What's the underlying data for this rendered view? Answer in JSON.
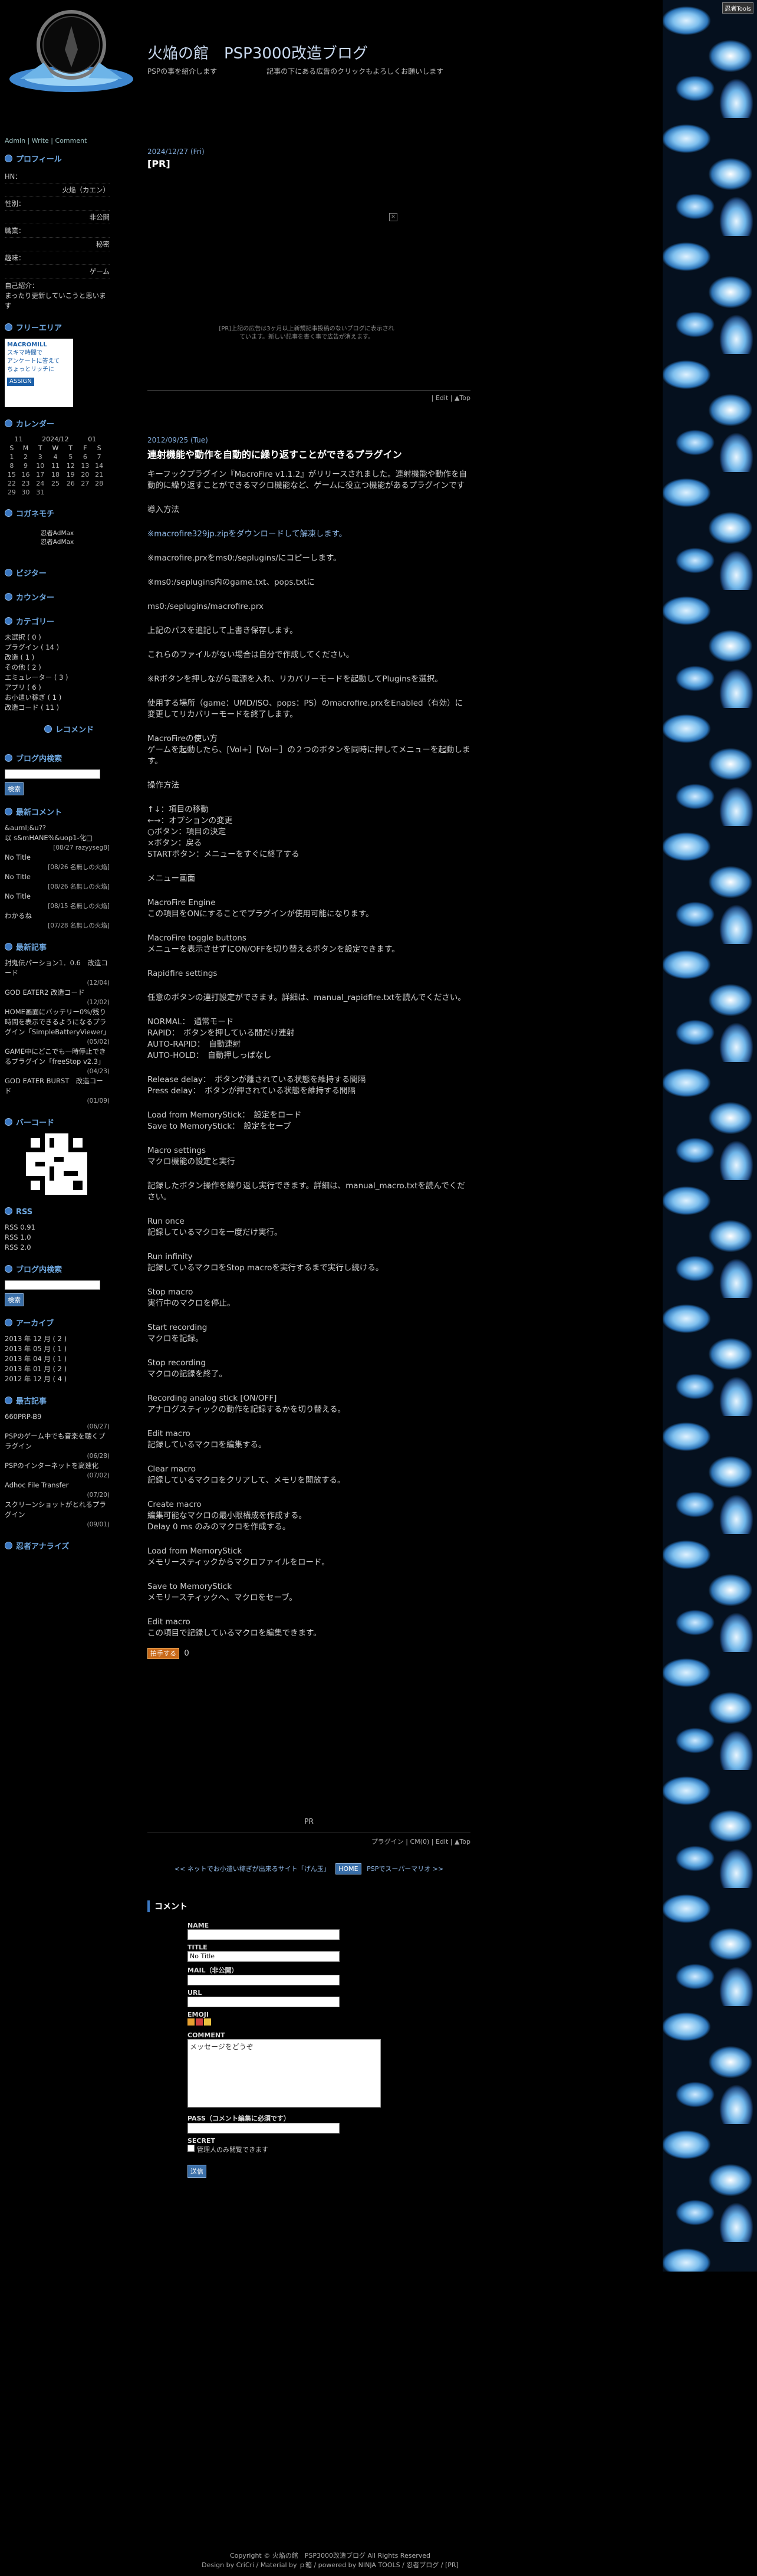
{
  "strip_badge": "忍者Tools",
  "site": {
    "title": "火焔の館　PSP3000改造ブログ",
    "description": "PSPの事を紹介します　　　　　　　記事の下にある広告のクリックもよろしくお願いします"
  },
  "sidebar": {
    "toplinks": "Admin | Write | Comment",
    "profile": {
      "title": "プロフィール",
      "rows": [
        {
          "label": "HN：",
          "value": ""
        },
        {
          "label": "",
          "value": "火焔（カエン）"
        },
        {
          "label": "性別：",
          "value": ""
        },
        {
          "label": "",
          "value": "非公開"
        },
        {
          "label": "職業：",
          "value": ""
        },
        {
          "label": "",
          "value": "秘密"
        },
        {
          "label": "趣味：",
          "value": ""
        },
        {
          "label": "",
          "value": "ゲーム"
        }
      ],
      "intro_label": "自己紹介：",
      "intro": "まったり更新していこうと思います"
    },
    "free": {
      "title": "フリーエリア",
      "banner_lines": [
        "MACROMILL",
        "スキマ時間で",
        "アンケートに答えて",
        "ちょっとリッチに",
        "ASSIGN"
      ]
    },
    "calendar": {
      "title": "カレンダー",
      "nav": [
        "11",
        "2024/12",
        "01"
      ],
      "weekdays": [
        "S",
        "M",
        "T",
        "W",
        "T",
        "F",
        "S"
      ],
      "weeks": [
        [
          "1",
          "2",
          "3",
          "4",
          "5",
          "6",
          "7"
        ],
        [
          "8",
          "9",
          "10",
          "11",
          "12",
          "13",
          "14"
        ],
        [
          "15",
          "16",
          "17",
          "18",
          "19",
          "20",
          "21"
        ],
        [
          "22",
          "23",
          "24",
          "25",
          "26",
          "27",
          "28"
        ],
        [
          "29",
          "30",
          "31",
          "",
          "",
          "",
          ""
        ]
      ]
    },
    "ad": {
      "title": "コガネモチ",
      "alt1": "忍者AdMax",
      "alt2": "忍者AdMax"
    },
    "visitor": {
      "title": "ビジター"
    },
    "counter": {
      "title": "カウンター"
    },
    "category": {
      "title": "カテゴリー",
      "items": [
        "未選択 ( 0 )",
        "プラグイン ( 14 )",
        "改造 ( 1 )",
        "その他 ( 2 )",
        "エミュレーター ( 3 )",
        "アプリ ( 6 )",
        "お小遣い稼ぎ ( 1 )",
        "改造コード ( 11 )"
      ]
    },
    "recommend": {
      "title": "レコメンド"
    },
    "search": {
      "title": "ブログ内検索",
      "button": "検索"
    },
    "comments": {
      "title": "最新コメント",
      "items": [
        {
          "text": "&auml;&u??",
          "sub": ""
        },
        {
          "text": "以 s&mHANE%&uop1-化□",
          "sub": "[08/27 razyyseg8]"
        },
        {
          "text": "No Title",
          "sub": "[08/26 名無しの火焔]"
        },
        {
          "text": "No Title",
          "sub": "[08/26 名無しの火焔]"
        },
        {
          "text": "No Title",
          "sub": "[08/15 名無しの火焔]"
        },
        {
          "text": "わかるね",
          "sub": "[07/28 名無しの火焔]"
        }
      ]
    },
    "recent": {
      "title": "最新記事",
      "items": [
        {
          "text": "封鬼伝パーション1．0.6　改造コード",
          "sub": "(12/04)"
        },
        {
          "text": "GOD EATER2 改造コード",
          "sub": "(12/02)"
        },
        {
          "text": "HOME画面にバッテリー0%/残り時間を表示できるようになるプラグイン「SimpleBatteryViewer」",
          "sub": "(05/02)"
        },
        {
          "text": "GAME中にどこでも一時停止できるプラグイン「freeStop v2.3」",
          "sub": "(04/23)"
        },
        {
          "text": "GOD EATER BURST　改造コード",
          "sub": "(01/09)"
        }
      ]
    },
    "barcode": {
      "title": "バーコード"
    },
    "rss": {
      "title": "RSS",
      "items": [
        "RSS 0.91",
        "RSS 1.0",
        "RSS 2.0"
      ]
    },
    "search2": {
      "title": "ブログ内検索",
      "button": "検索"
    },
    "archive": {
      "title": "アーカイブ",
      "items": [
        "2013 年 12 月 ( 2 )",
        "2013 年 05 月 ( 1 )",
        "2013 年 04 月 ( 1 )",
        "2013 年 01 月 ( 2 )",
        "2012 年 12 月 ( 4 )"
      ]
    },
    "oldest": {
      "title": "最古記事",
      "items": [
        {
          "text": "660PRP-B9",
          "sub": "(06/27)"
        },
        {
          "text": "PSPのゲーム中でも音楽を聴くプラグイン",
          "sub": "(06/28)"
        },
        {
          "text": "PSPのインターネットを高速化",
          "sub": "(07/02)"
        },
        {
          "text": "Adhoc File Transfer",
          "sub": "(07/20)"
        },
        {
          "text": "スクリーンショットがとれるプラグイン",
          "sub": "(09/01)"
        }
      ]
    },
    "ninja": {
      "title": "忍者アナライズ"
    }
  },
  "main": {
    "pr": {
      "date": "2024/12/27 (Fri)",
      "title": "[PR]",
      "note": "[PR]上記の広告は3ヶ月以上新規記事投稿のないブログに表示されています。新しい記事を書く事で広告が消えます。",
      "foot": "| Edit | ▲Top"
    },
    "entry": {
      "date": "2012/09/25 (Tue)",
      "title": "連射機能や動作を自動的に繰り返すことができるプラグイン",
      "paragraphs": [
        "キーフックプラグイン『MacroFire v1.1.2』がリリースされました。連射機能や動作を自動的に繰り返すことができるマクロ機能など、ゲームに役立つ機能があるプラグインです",
        "導入方法",
        "※macrofire329jp.zipをダウンロードして解凍します。",
        "※macrofire.prxをms0:/seplugins/にコピーします。",
        "※ms0:/seplugins内のgame.txt、pops.txtに",
        "ms0:/seplugins/macrofire.prx",
        "上記のパスを追記して上書き保存します。",
        "これらのファイルがない場合は自分で作成してください。",
        "※Rボタンを押しながら電源を入れ、リカバリーモードを起動してPluginsを選択。",
        "使用する場所（game：UMD/ISO、pops：PS）のmacrofire.prxをEnabled（有効）に変更してリカバリーモードを終了します。",
        "MacroFireの使い方\nゲームを起動したら、[Vol+］[Vol－］の２つのボタンを同時に押してメニューを起動します。",
        "操作方法",
        "↑↓：項目の移動\n←→：オプションの変更\n○ボタン：項目の決定\n×ボタン：戻る\nSTARTボタン：メニューをすぐに終了する",
        "メニュー画面",
        "MacroFire Engine\nこの項目をONにすることでプラグインが使用可能になります。",
        "MacroFire toggle buttons\nメニューを表示させずにON/OFFを切り替えるボタンを設定できます。",
        "Rapidfire settings",
        "任意のボタンの連打設定ができます。詳細は、manual_rapidfire.txtを読んでください。",
        "NORMAL：　通常モード\nRAPID：　ボタンを押している間だけ連射\nAUTO-RAPID：　自動連射\nAUTO-HOLD：　自動押しっぱなし",
        "Release delay：　ボタンが離されている状態を維持する間隔\nPress delay：　ボタンが押されている状態を維持する間隔",
        "Load from MemoryStick：　設定をロード\nSave to MemoryStick：　設定をセーブ",
        "Macro settings\nマクロ機能の設定と実行",
        "記録したボタン操作を繰り返し実行できます。詳細は、manual_macro.txtを読んでください。",
        "Run once\n記録しているマクロを一度だけ実行。",
        "Run infinity\n記録しているマクロをStop macroを実行するまで実行し続ける。",
        "Stop macro\n実行中のマクロを停止。",
        "Start recording\nマクロを記録。",
        "Stop recording\nマクロの記録を終了。",
        "Recording analog stick [ON/OFF]\nアナログスティックの動作を記録するかを切り替える。",
        "Edit macro\n記録しているマクロを編集する。",
        "Clear macro\n記録しているマクロをクリアして、メモリを開放する。",
        "Create macro\n編集可能なマクロの最小限構成を作成する。\nDelay 0 ms のみのマクロを作成する。",
        "Load from MemoryStick\nメモリースティックからマクロファイルをロード。",
        "Save to MemoryStick\nメモリースティックへ、マクロをセーブ。",
        "Edit macro\nこの項目で記録しているマクロを編集できます。"
      ],
      "clap_label": "拍手する",
      "clap_count": "0",
      "pr_text": "PR",
      "foot": "プラグイン | CM(0) | Edit | ▲Top",
      "nav_prev": "<< ネットでお小遣い稼ぎが出来るサイト「げん玉」",
      "nav_home": "HOME",
      "nav_next": "PSPでスーパーマリオ >>"
    },
    "comment_form": {
      "title": "コメント",
      "name": "NAME",
      "title_label": "TITLE",
      "title_value": "No Title",
      "mail": "MAIL（非公開）",
      "url": "URL",
      "emoji": "EMOJI",
      "comment": "COMMENT",
      "comment_placeholder": "メッセージをどうぞ",
      "pass": "PASS（コメント編集に必須です）",
      "secret": "SECRET",
      "secret_label": "管理人のみ閲覧できます",
      "submit": "送信"
    }
  },
  "footer": {
    "line1": "Copyright © 火焔の館　PSP3000改造ブログ All Rights Reserved",
    "line2": "Design by CriCri / Material by ｐ箱 / powered by NINJA TOOLS / 忍者ブログ / [PR]"
  },
  "colors": {
    "accent": "#3b78c2",
    "link": "#8fb8e6",
    "background": "#000000"
  }
}
